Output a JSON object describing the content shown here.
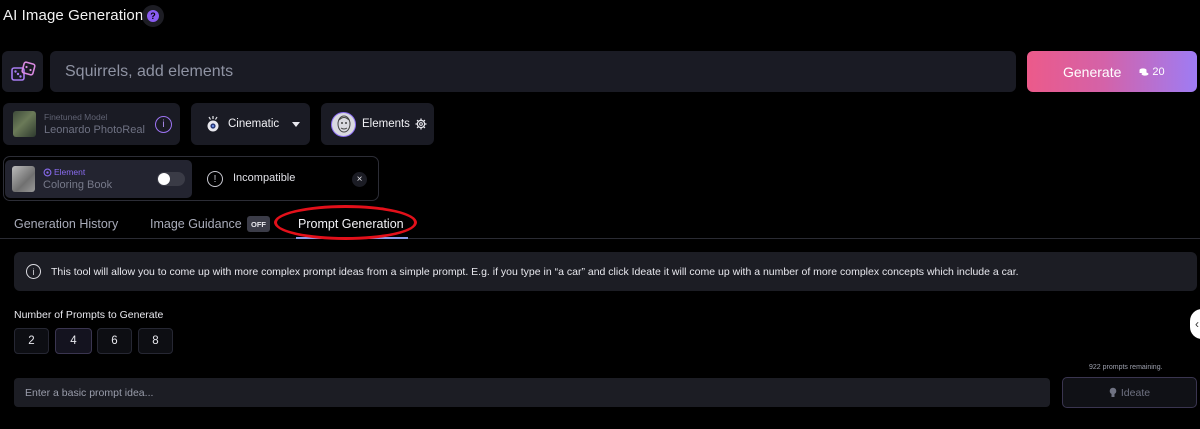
{
  "header": {
    "title": "AI Image Generation",
    "help_icon": "question-mark-icon"
  },
  "prompt": {
    "placeholder": "Squirrels, add elements",
    "random_icon": "dice-icon"
  },
  "generate": {
    "label": "Generate",
    "cost": "20",
    "cost_icon": "token-icon"
  },
  "model": {
    "subtitle": "Finetuned Model",
    "name": "Leonardo PhotoReal",
    "info_icon": "info-icon"
  },
  "style": {
    "label": "Cinematic",
    "icon": "camera-lens-icon"
  },
  "elements": {
    "label": "Elements",
    "settings_icon": "gear-icon"
  },
  "element_card": {
    "tag": "Element",
    "name": "Coloring Book",
    "enabled": false
  },
  "incompatible": {
    "label": "Incompatible",
    "close": "×"
  },
  "tabs": {
    "history": "Generation History",
    "guidance": "Image Guidance",
    "guidance_badge": "OFF",
    "prompt_generation": "Prompt Generation",
    "active": "prompt_generation"
  },
  "info": {
    "text": "This tool will allow you to come up with more complex prompt ideas from a simple prompt. E.g. if you type in “a car” and click Ideate it will come up with a number of more complex concepts which include a car."
  },
  "num_prompts": {
    "label": "Number of Prompts to Generate",
    "options": [
      "2",
      "4",
      "6",
      "8"
    ],
    "selected": "4"
  },
  "ideate": {
    "remaining": "922 prompts remaining.",
    "placeholder": "Enter a basic prompt idea...",
    "button": "Ideate",
    "icon": "lightbulb-icon"
  },
  "colors": {
    "background": "#000000",
    "surface": "#1a1b24",
    "accent_purple": "#8a6cf0",
    "generate_gradient_start": "#ec5a8a",
    "generate_gradient_end": "#9e7cf4",
    "highlight_ring": "#e3101a"
  }
}
